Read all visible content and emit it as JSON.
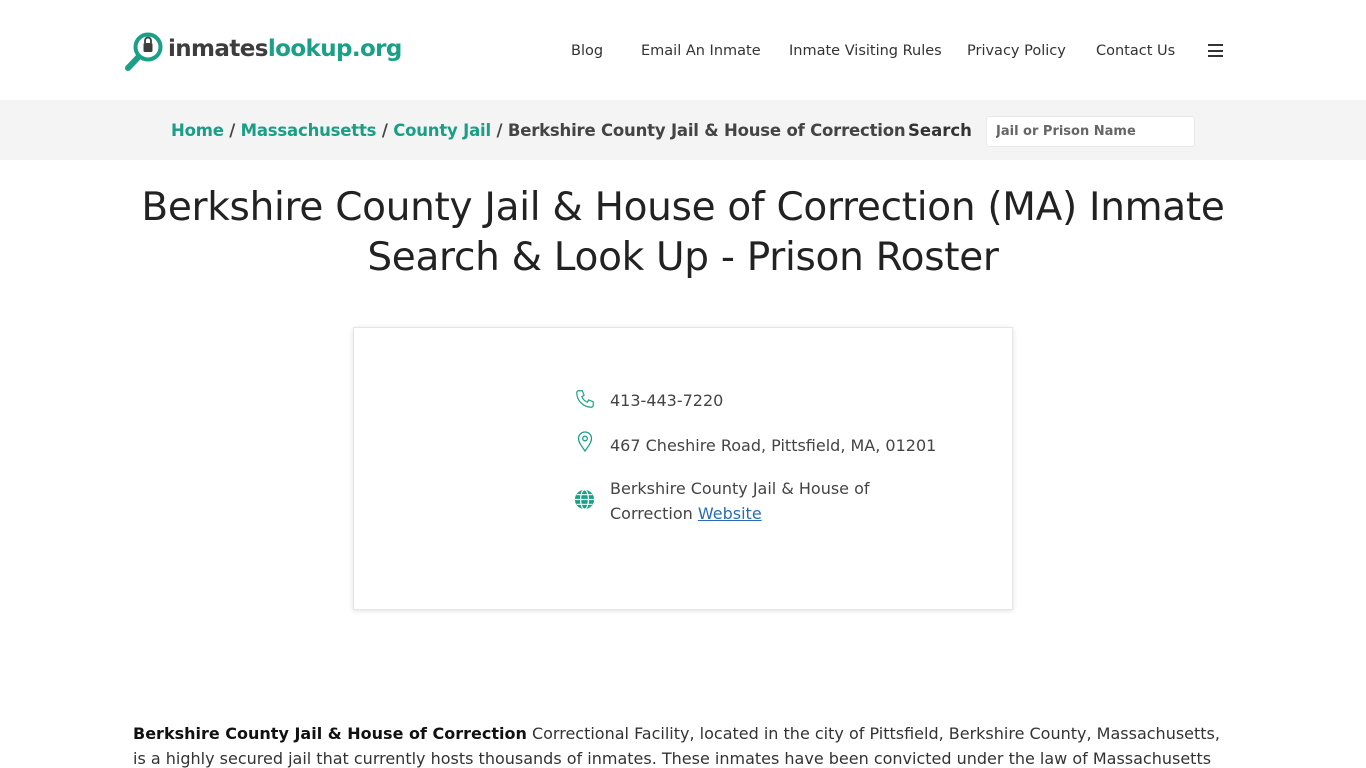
{
  "header": {
    "logo_part1": "inmates",
    "logo_part2": "lookup.org",
    "nav": [
      {
        "label": "Blog"
      },
      {
        "label": "Email An Inmate"
      },
      {
        "label": "Inmate Visiting Rules"
      },
      {
        "label": "Privacy Policy"
      },
      {
        "label": "Contact Us"
      }
    ]
  },
  "breadcrumb": {
    "items": [
      "Home",
      "Massachusetts",
      "County Jail"
    ],
    "separator": "/",
    "current": "Berkshire County Jail & House of Correction"
  },
  "search": {
    "label": "Search",
    "placeholder": "Jail or Prison Name"
  },
  "page": {
    "title_line1": "Berkshire County Jail & House of Correction (MA) Inmate",
    "title_line2": "Search & Look Up - Prison Roster"
  },
  "facility": {
    "phone": "413-443-7220",
    "address": "467 Cheshire Road, Pittsfield, MA, 01201",
    "website_text_line1": "Berkshire County Jail & House of",
    "website_text_line2": "Correction",
    "website_link": "Website"
  },
  "description": {
    "bold_name": "Berkshire County Jail & House of Correction",
    "text": " Correctional Facility, located in the city of Pittsfield, Berkshire County, Massachusetts, is a highly secured jail that currently hosts thousands of inmates. These inmates have been convicted under the law of Massachusetts state and according to"
  },
  "colors": {
    "accent": "#1aa087",
    "link": "#2a6db5",
    "bar_bg": "#f4f4f4"
  },
  "icons": [
    "magnifier-logo-icon",
    "hamburger-menu-icon",
    "phone-icon",
    "map-pin-icon",
    "globe-icon"
  ]
}
